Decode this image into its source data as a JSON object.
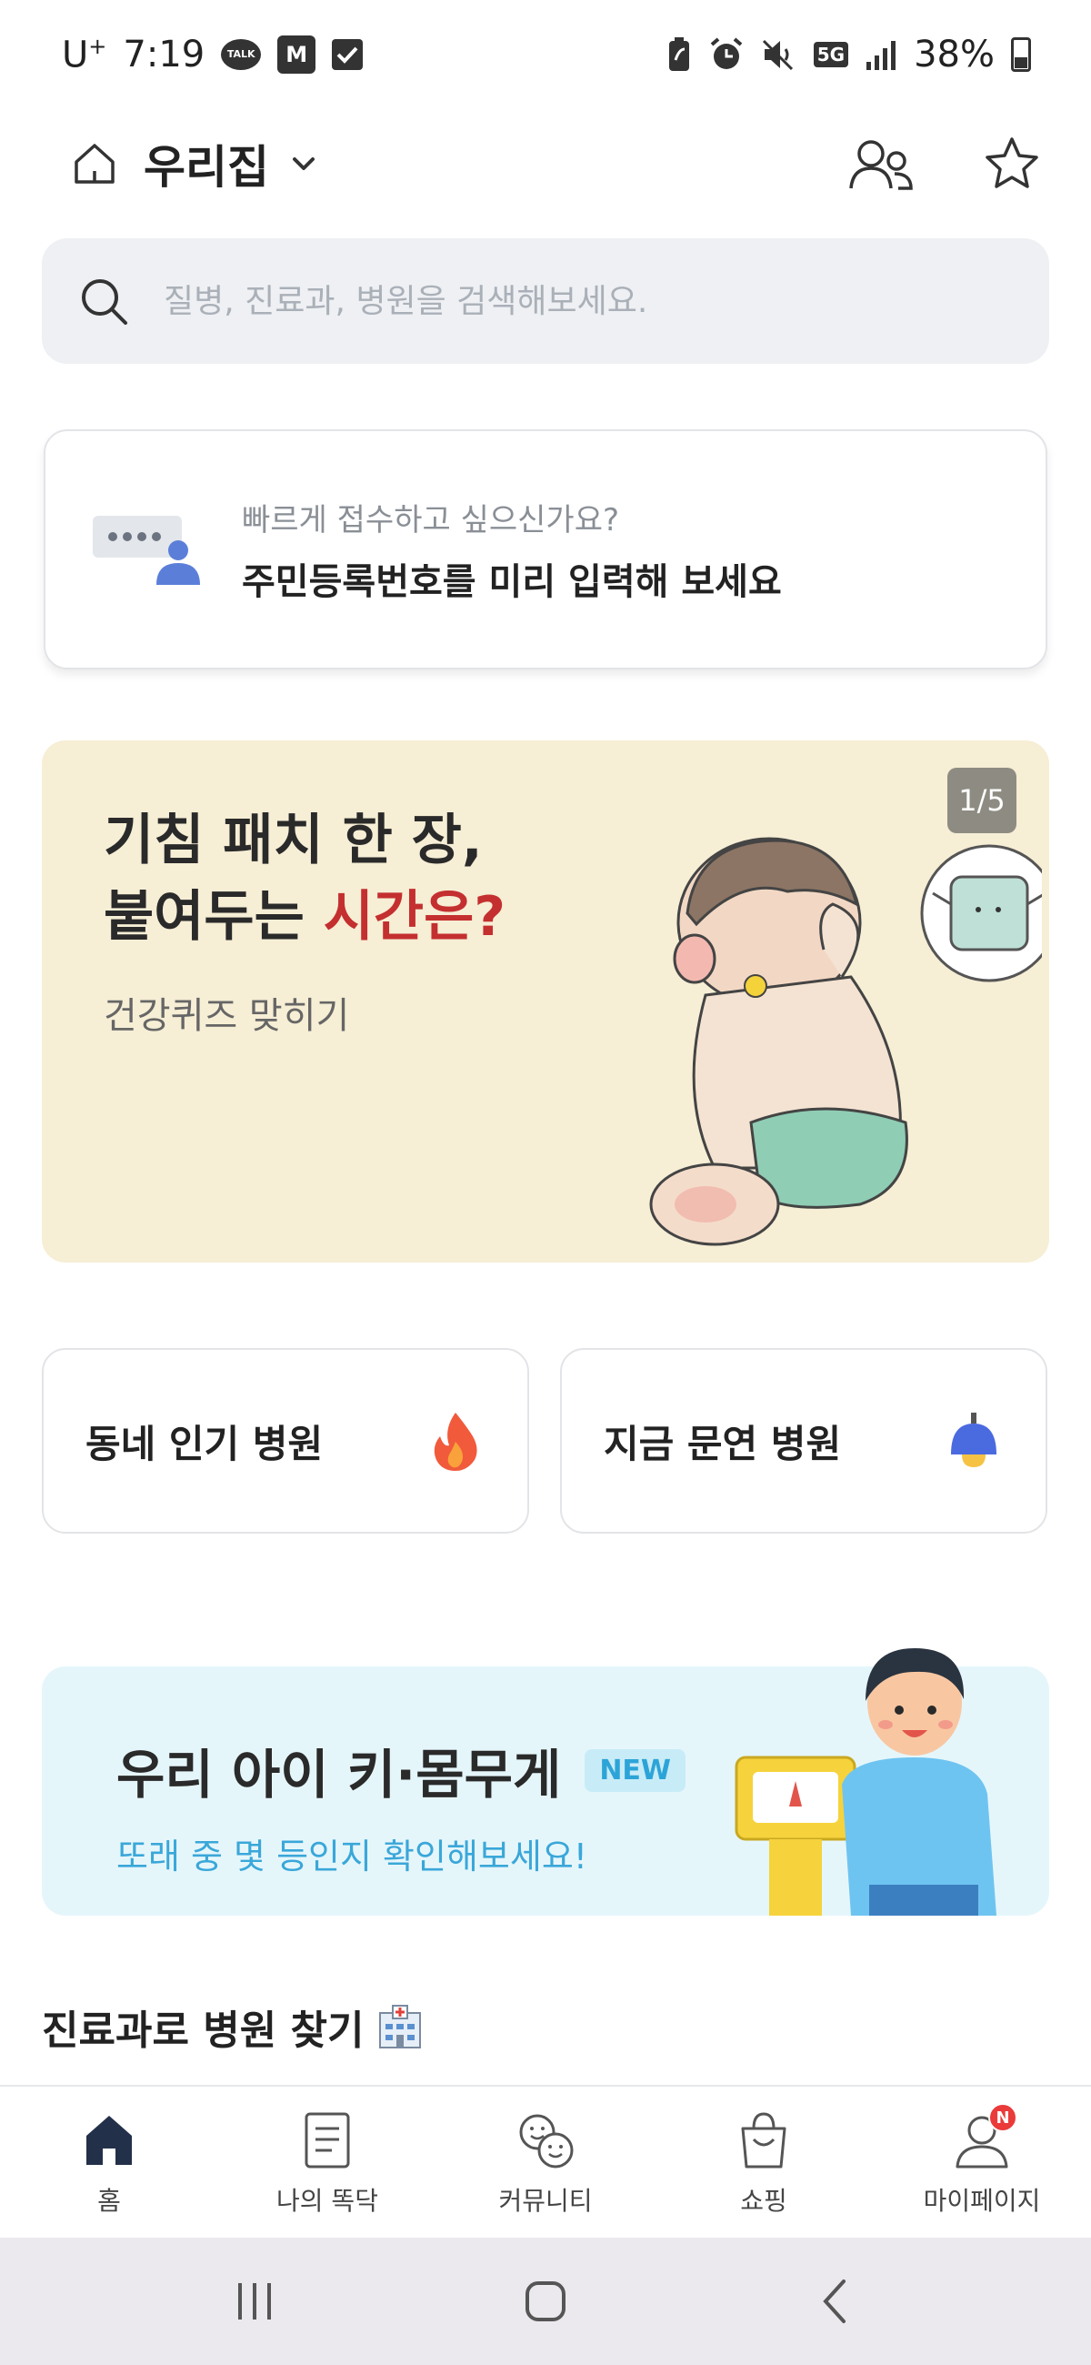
{
  "status_bar": {
    "carrier": "U",
    "carrier_sup": "+",
    "time": "7:19",
    "talk_label": "TALK",
    "mstock_label": "M",
    "network": "5G",
    "battery": "38%"
  },
  "header": {
    "title": "우리집"
  },
  "search": {
    "placeholder": "질병, 진료과, 병원을 검색해보세요."
  },
  "registration_card": {
    "subtitle": "빠르게 접수하고 싶으신가요?",
    "title": "주민등록번호를 미리 입력해 보세요"
  },
  "banner": {
    "title_line1": "기침 패치 한 장,",
    "title_line2_prefix": "붙여두는 ",
    "title_line2_highlight": "시간은?",
    "subtitle": "건강퀴즈 맞히기",
    "counter": "1/5"
  },
  "quick_buttons": {
    "popular": "동네 인기 병원",
    "open_now": "지금 문연 병원"
  },
  "growth_banner": {
    "title": "우리 아이 키·몸무게",
    "badge": "NEW",
    "subtitle": "또래 중 몇 등인지 확인해보세요!"
  },
  "section": {
    "title": "진료과로 병원 찾기"
  },
  "bottom_nav": {
    "items": [
      {
        "label": "홈"
      },
      {
        "label": "나의 똑닥"
      },
      {
        "label": "커뮤니티"
      },
      {
        "label": "쇼핑"
      },
      {
        "label": "마이페이지"
      }
    ],
    "badge": "N"
  },
  "colors": {
    "accent_red": "#c42f2f",
    "banner_bg": "#f6eed5",
    "growth_bg": "#e5f6fb",
    "growth_sub": "#3aa7d9",
    "search_bg": "#eef0f3",
    "nav_badge": "#ea3a3a"
  },
  "icons": {
    "header_home": "home-outline-icon",
    "family": "family-icon",
    "favorite": "star-icon",
    "search": "search-icon",
    "popular": "flame-icon",
    "open_now": "bell-lamp-icon",
    "hospital": "hospital-icon"
  }
}
